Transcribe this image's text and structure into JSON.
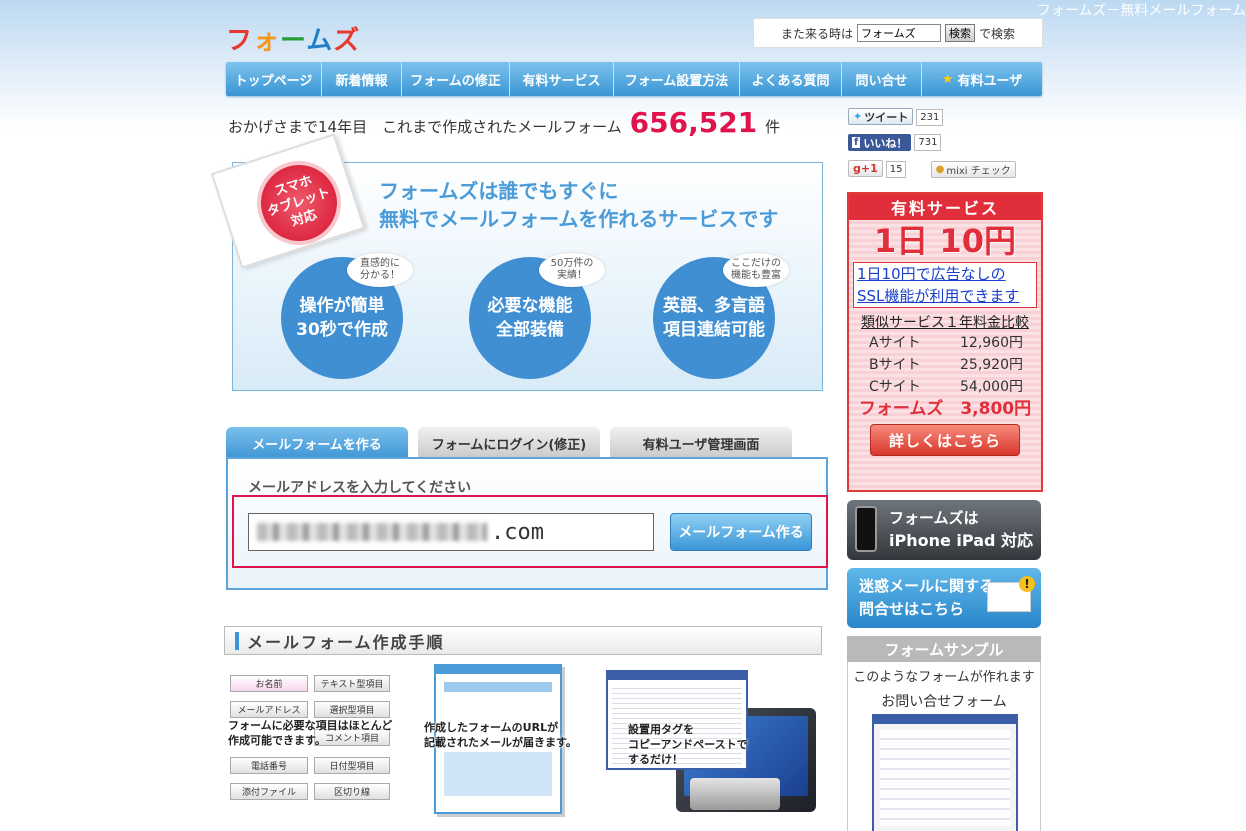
{
  "corner_title": "フォームズ－無料メールフォーム",
  "logo": [
    "フ",
    "ォ",
    "ー",
    "ム",
    "ズ"
  ],
  "search": {
    "label": "また来る時は",
    "value": "フォームズ",
    "button": "検索",
    "suffix": "で検索"
  },
  "nav": [
    "トップページ",
    "新着情報",
    "フォームの修正",
    "有料サービス",
    "フォーム設置方法",
    "よくある質問",
    "問い合せ",
    "有料ユーザ"
  ],
  "counter": {
    "prefix": "おかげさまで14年目　これまで作成されたメールフォーム",
    "number": "656,521",
    "suffix": "件"
  },
  "hero": {
    "title_line1": "フォームズは誰でもすぐに",
    "title_line2": "無料でメールフォームを作れるサービスです",
    "badge": "スマホ\nタブレット\n対応",
    "features": [
      {
        "bubble": "直感的に\n分かる！",
        "text": "操作が簡単\n30秒で作成"
      },
      {
        "bubble": "50万件の\n実績！",
        "text": "必要な機能\n全部装備"
      },
      {
        "bubble": "ここだけの\n機能も豊富",
        "text": "英語、多言語\n項目連結可能"
      }
    ]
  },
  "tabs": [
    "メールフォームを作る",
    "フォームにログイン(修正)",
    "有料ユーザ管理画面"
  ],
  "form": {
    "prompt": "メールアドレスを入力してください",
    "email_suffix": ".com",
    "submit": "メールフォーム作る"
  },
  "steps": {
    "header": "メールフォーム作成手順",
    "step1_fields": [
      "お名前",
      "テキスト型項目",
      "メールアドレス",
      "選択型項目",
      "コメント項目",
      "電話番号",
      "日付型項目",
      "添付ファイル",
      "区切り線"
    ],
    "step1_text": "フォームに必要な項目はほとんど\n作成可能できます。",
    "step2_text": "作成したフォームのURLが\n記載されたメールが届きます。",
    "step3_text": "設置用タグを\nコピーアンドペーストで\nするだけ！"
  },
  "social": {
    "tweet": "ツイート",
    "tweet_count": "231",
    "like": "いいね！",
    "like_count": "731",
    "gplus": "+1",
    "gplus_count": "15",
    "mixi": "mixi チェック"
  },
  "paid": {
    "title": "有料サービス",
    "price": "1日 10円",
    "link_line1": "1日10円で広告なしの",
    "link_line2": "SSL機能が利用できます",
    "compare_title": "類似サービス１年料金比較",
    "rows": [
      {
        "name": "Aサイト",
        "price": "12,960円"
      },
      {
        "name": "Bサイト",
        "price": "25,920円"
      },
      {
        "name": "Cサイト",
        "price": "54,000円"
      }
    ],
    "ours": "フォームズ　3,800円",
    "button": "詳しくはこちら"
  },
  "banners": {
    "iphone_line1": "フォームズは",
    "iphone_line2": "iPhone iPad 対応",
    "spam_line1": "迷惑メールに関する",
    "spam_line2": "問合せはこちら"
  },
  "sample": {
    "title": "フォームサンプル",
    "desc": "このようなフォームが作れます",
    "caption": "お問い合せフォーム"
  },
  "colors": {
    "accent": "#3f95d4",
    "counter_red": "#e0144c",
    "paid_red": "#e02e3a"
  }
}
